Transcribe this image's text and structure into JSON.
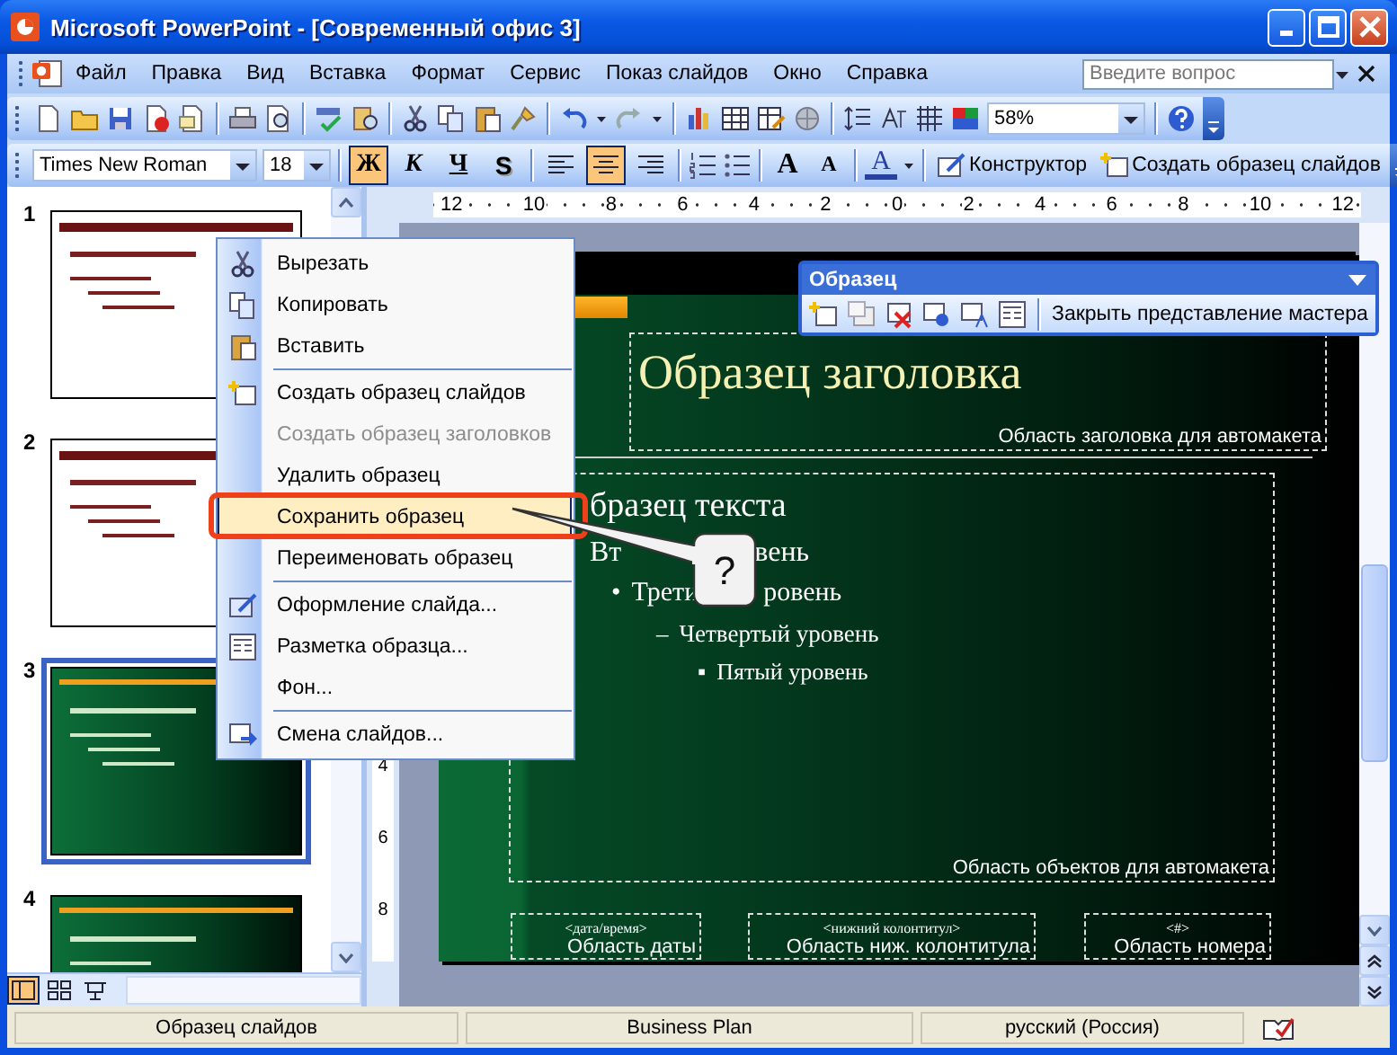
{
  "window": {
    "title": "Microsoft PowerPoint - [Современный офис 3]"
  },
  "menu_bar": {
    "items": [
      "Файл",
      "Правка",
      "Вид",
      "Вставка",
      "Формат",
      "Сервис",
      "Показ слайдов",
      "Окно",
      "Справка"
    ],
    "help_search": {
      "placeholder": "Введите вопрос"
    }
  },
  "standard_toolbar": {
    "zoom": "58%"
  },
  "formatting_toolbar": {
    "font": "Times New Roman",
    "size": "18",
    "styles": [
      {
        "label": "Ж",
        "selected": true
      },
      {
        "label": "К",
        "selected": false
      },
      {
        "label": "Ч",
        "selected": false
      },
      {
        "label": "S",
        "selected": false
      }
    ],
    "alignments": [
      {
        "selected": false
      },
      {
        "selected": true
      },
      {
        "selected": false
      }
    ],
    "font_size_buttons": [
      "A",
      "A"
    ],
    "font_color": "A",
    "buttons": [
      "Конструктор",
      "Создать образец слайдов"
    ]
  },
  "thumbnails": [
    {
      "number": "1",
      "kind": "light",
      "selected": false
    },
    {
      "number": "2",
      "kind": "light",
      "selected": false
    },
    {
      "number": "3",
      "kind": "dark",
      "selected": true
    },
    {
      "number": "4",
      "kind": "dark",
      "selected": false
    }
  ],
  "horizontal_ruler": [
    "12",
    "10",
    "8",
    "6",
    "4",
    "2",
    "0",
    "2",
    "4",
    "6",
    "8",
    "10",
    "12"
  ],
  "vertical_ruler": [
    "4",
    "6",
    "8"
  ],
  "context_menu": {
    "items": [
      {
        "label": "Вырезать",
        "disabled": false,
        "selected": false,
        "separator_before": false
      },
      {
        "label": "Копировать",
        "disabled": false,
        "selected": false,
        "separator_before": false
      },
      {
        "label": "Вставить",
        "disabled": false,
        "selected": false,
        "separator_before": false
      },
      {
        "label": "Создать образец слайдов",
        "disabled": false,
        "selected": false,
        "separator_before": true
      },
      {
        "label": "Создать образец заголовков",
        "disabled": true,
        "selected": false,
        "separator_before": false
      },
      {
        "label": "Удалить образец",
        "disabled": false,
        "selected": false,
        "separator_before": false
      },
      {
        "label": "Сохранить образец",
        "disabled": false,
        "selected": true,
        "separator_before": false
      },
      {
        "label": "Переименовать образец",
        "disabled": false,
        "selected": false,
        "separator_before": false
      },
      {
        "label": "Оформление слайда...",
        "disabled": false,
        "selected": false,
        "separator_before": true
      },
      {
        "label": "Разметка образца...",
        "disabled": false,
        "selected": false,
        "separator_before": false
      },
      {
        "label": "Фон...",
        "disabled": false,
        "selected": false,
        "separator_before": false
      },
      {
        "label": "Смена слайдов...",
        "disabled": false,
        "selected": false,
        "separator_before": true
      }
    ]
  },
  "callout": {
    "text": "?"
  },
  "master_toolbar": {
    "title": "Образец",
    "close_button": "Закрыть представление мастера"
  },
  "slide": {
    "title": "Образец заголовка",
    "title_area": "Область заголовка для автомакета",
    "body": [
      {
        "text": "бразец текста",
        "children": [
          {
            "text": "Вт",
            "text_after": "вень",
            "children": [
              {
                "bullet": "•",
                "text": "Трети",
                "text_after": "ровень",
                "children": [
                  {
                    "bullet": "–",
                    "text": "Четвертый уровень",
                    "children": [
                      {
                        "bullet": "▪",
                        "text": "Пятый уровень"
                      }
                    ]
                  }
                ]
              }
            ]
          }
        ]
      }
    ],
    "object_area": "Область объектов для автомакета",
    "footer_areas": [
      {
        "field": "<дата/время>",
        "label": "Область даты"
      },
      {
        "field": "<нижний колонтитул>",
        "label": "Область ниж. колонтитула"
      },
      {
        "field": "<#>",
        "label": "Область номера"
      }
    ]
  },
  "status_bar": [
    "Образец слайдов",
    "Business Plan",
    "русский (Россия)"
  ]
}
